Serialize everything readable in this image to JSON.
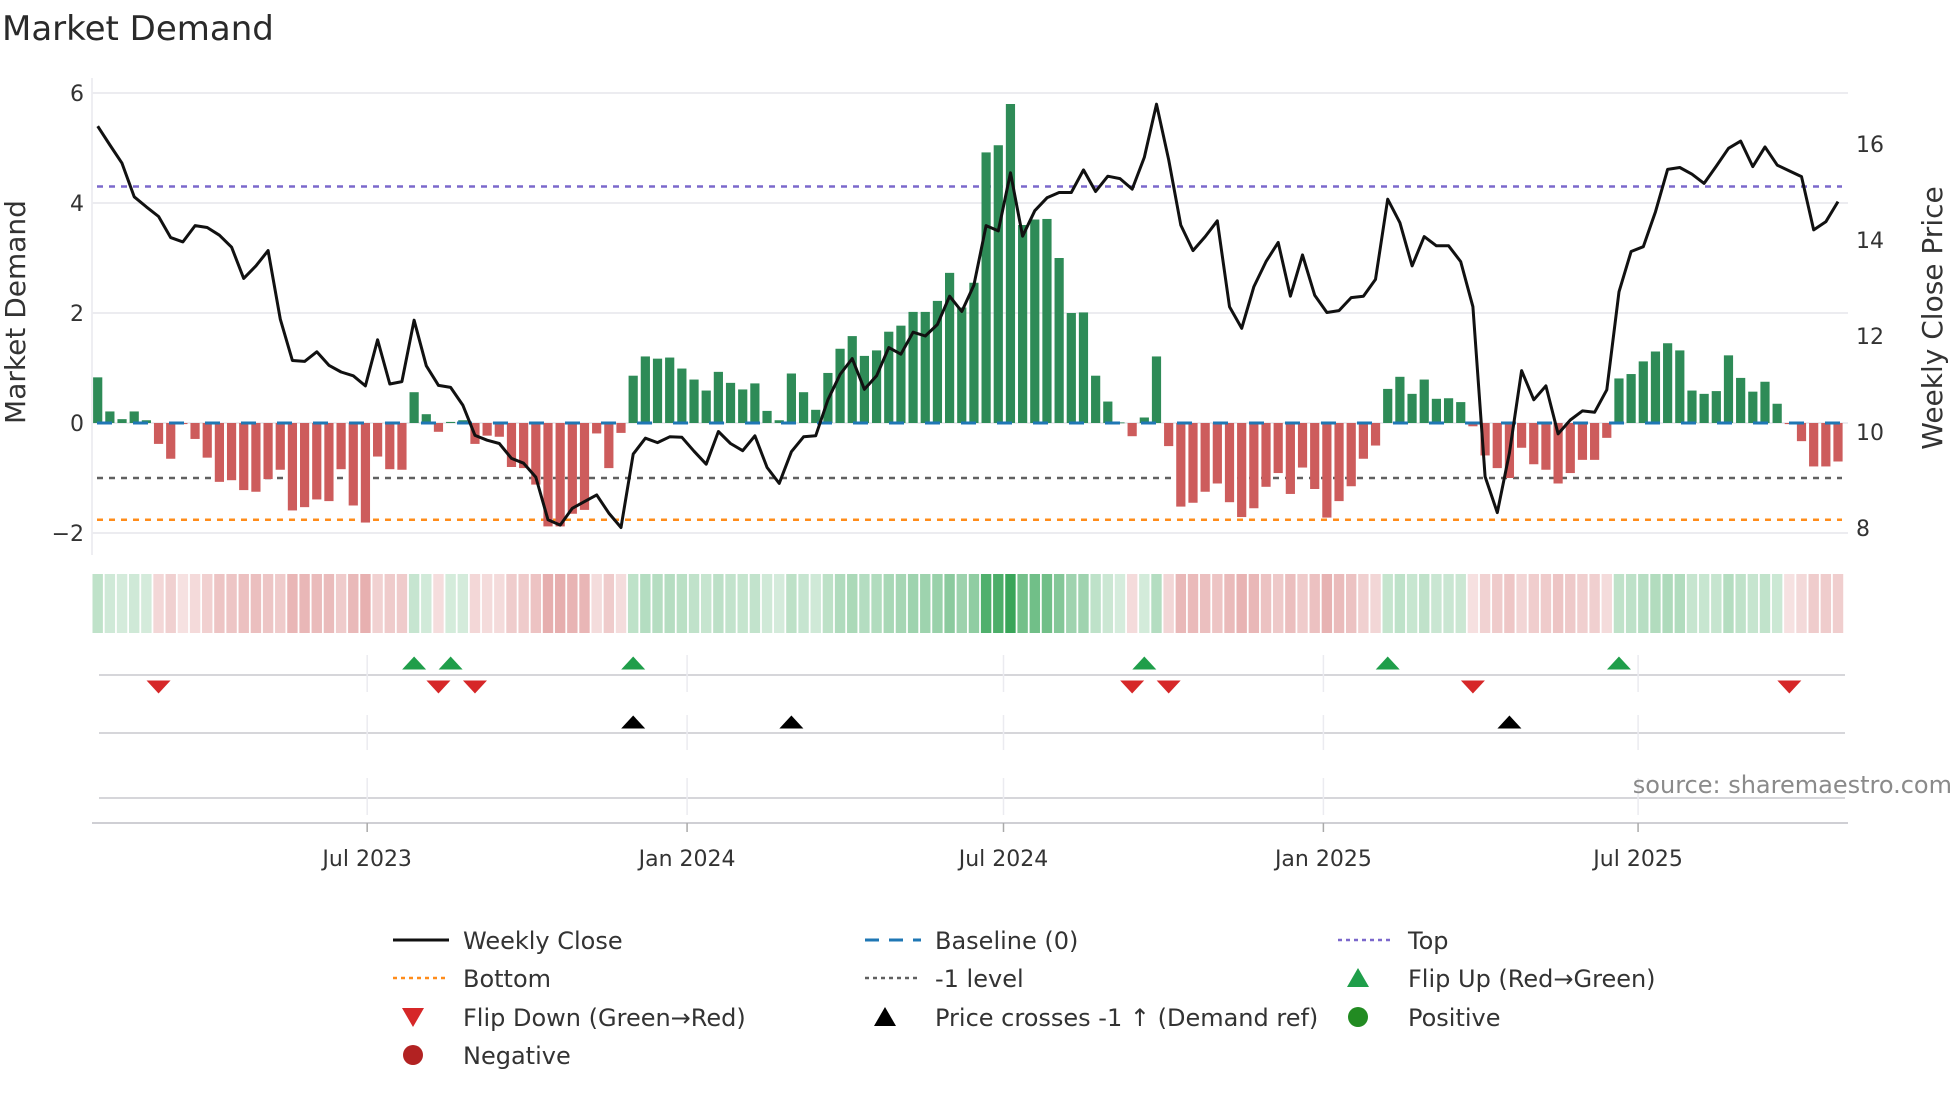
{
  "chart_data": {
    "type": "bar",
    "title": "Market Demand",
    "ylabel": "Market Demand",
    "y2label": "Weekly Close Price",
    "ylim": [
      -2.25,
      6.3
    ],
    "y2lim": [
      7.8,
      17.2
    ],
    "yticks": [
      "6",
      "4",
      "2",
      "0",
      "−2"
    ],
    "ytick_values": [
      6,
      4,
      2,
      0,
      -2
    ],
    "y2ticks": [
      "16",
      "14",
      "12",
      "10",
      "8"
    ],
    "y2tick_values": [
      16,
      14,
      12,
      10,
      8
    ],
    "x_start_date": "2023-01-27",
    "x_frequency": "weekly",
    "xticks": [
      {
        "label": "Jul 2023",
        "date": "2023-07-01"
      },
      {
        "label": "Jan 2024",
        "date": "2024-01-01"
      },
      {
        "label": "Jul 2024",
        "date": "2024-07-01"
      },
      {
        "label": "Jan 2025",
        "date": "2025-01-01"
      },
      {
        "label": "Jul 2025",
        "date": "2025-07-01"
      }
    ],
    "grid": true,
    "series": [
      {
        "name": "Market Demand",
        "kind": "bar",
        "values": [
          0.83,
          0.21,
          0.07,
          0.21,
          0.05,
          -0.38,
          -0.65,
          -0.02,
          -0.29,
          -0.63,
          -1.07,
          -1.04,
          -1.22,
          -1.25,
          -1.02,
          -0.85,
          -1.59,
          -1.53,
          -1.39,
          -1.42,
          -0.84,
          -1.5,
          -1.81,
          -0.61,
          -0.84,
          -0.85,
          0.56,
          0.16,
          -0.16,
          0.02,
          0.05,
          -0.38,
          -0.23,
          -0.25,
          -0.8,
          -0.82,
          -1.12,
          -1.88,
          -1.88,
          -1.65,
          -1.58,
          -0.19,
          -0.82,
          -0.18,
          0.86,
          1.21,
          1.17,
          1.19,
          0.99,
          0.79,
          0.59,
          0.93,
          0.73,
          0.61,
          0.72,
          0.22,
          0.05,
          0.9,
          0.56,
          0.24,
          0.91,
          1.35,
          1.58,
          1.22,
          1.32,
          1.66,
          1.77,
          2.02,
          2.02,
          2.22,
          2.73,
          2.1,
          2.55,
          4.92,
          5.05,
          5.8,
          3.6,
          3.7,
          3.71,
          3.0,
          2.0,
          2.01,
          0.86,
          0.39,
          0.01,
          -0.24,
          0.1,
          1.21,
          -0.42,
          -1.52,
          -1.45,
          -1.25,
          -1.1,
          -1.44,
          -1.71,
          -1.55,
          -1.16,
          -0.91,
          -1.29,
          -0.81,
          -1.2,
          -1.72,
          -1.42,
          -1.15,
          -0.65,
          -0.41,
          0.62,
          0.84,
          0.53,
          0.79,
          0.44,
          0.45,
          0.38,
          -0.06,
          -0.59,
          -0.82,
          -1.0,
          -0.45,
          -0.75,
          -0.85,
          -1.1,
          -0.91,
          -0.67,
          -0.67,
          -0.27,
          0.81,
          0.89,
          1.12,
          1.3,
          1.45,
          1.32,
          0.59,
          0.53,
          0.58,
          1.23,
          0.82,
          0.57,
          0.75,
          0.35,
          -0.02,
          -0.33,
          -0.79,
          -0.79,
          -0.7
        ]
      },
      {
        "name": "Weekly Close",
        "kind": "line",
        "axis": "right",
        "values": [
          16.37,
          15.98,
          15.6,
          14.9,
          14.69,
          14.49,
          14.05,
          13.96,
          14.3,
          14.26,
          14.1,
          13.85,
          13.2,
          13.46,
          13.78,
          12.35,
          11.49,
          11.47,
          11.67,
          11.39,
          11.25,
          11.17,
          10.96,
          11.92,
          11.0,
          11.05,
          12.33,
          11.38,
          10.97,
          10.93,
          10.56,
          9.93,
          9.83,
          9.76,
          9.45,
          9.35,
          9.06,
          8.17,
          8.06,
          8.41,
          8.55,
          8.69,
          8.31,
          8.01,
          9.54,
          9.87,
          9.78,
          9.9,
          9.89,
          9.6,
          9.33,
          10.01,
          9.76,
          9.61,
          9.92,
          9.26,
          8.93,
          9.59,
          9.9,
          9.92,
          10.67,
          11.2,
          11.53,
          10.89,
          11.17,
          11.76,
          11.62,
          12.08,
          12.0,
          12.24,
          12.83,
          12.51,
          13.06,
          14.3,
          14.19,
          15.4,
          14.08,
          14.61,
          14.88,
          14.99,
          14.99,
          15.46,
          15.01,
          15.33,
          15.28,
          15.06,
          15.72,
          16.83,
          15.67,
          14.31,
          13.78,
          14.07,
          14.4,
          12.61,
          12.16,
          13.03,
          13.55,
          13.95,
          12.83,
          13.69,
          12.85,
          12.49,
          12.53,
          12.8,
          12.83,
          13.18,
          14.85,
          14.36,
          13.46,
          14.07,
          13.88,
          13.88,
          13.55,
          12.61,
          9.07,
          8.32,
          9.56,
          11.28,
          10.67,
          10.96,
          9.96,
          10.25,
          10.44,
          10.41,
          10.88,
          12.92,
          13.76,
          13.86,
          14.59,
          15.47,
          15.51,
          15.37,
          15.18,
          15.54,
          15.91,
          16.06,
          15.53,
          15.94,
          15.56,
          15.44,
          15.32,
          14.21,
          14.38,
          14.8
        ]
      }
    ],
    "levels": {
      "top": 4.3,
      "bottom": -1.76,
      "minus_one": -1,
      "baseline": 0
    },
    "markers": {
      "flip_up_week_index": [
        26,
        29,
        44,
        86,
        106,
        125
      ],
      "flip_down_week_index": [
        5,
        28,
        31,
        85,
        88,
        113,
        139
      ],
      "price_cross_week_index": [
        44,
        57,
        116
      ]
    },
    "colors": {
      "positive_bar": "#2e8b57",
      "negative_bar": "#cd5c5c",
      "close_line": "#111111",
      "baseline": "#1f77b4",
      "top": "#7b68cc",
      "bottom": "#ff8c1a",
      "minus_one": "#606060",
      "flip_up": "#1f9e4a",
      "flip_down": "#d62728",
      "price_cross": "#000000",
      "positive_dot": "#228b22",
      "negative_dot": "#b22222"
    },
    "legend_position": "bottom",
    "legend": [
      {
        "label": "Weekly Close",
        "kind": "line"
      },
      {
        "label": "Baseline (0)",
        "kind": "dash"
      },
      {
        "label": "Top",
        "kind": "dot-top"
      },
      {
        "label": "Bottom",
        "kind": "dot-bottom"
      },
      {
        "label": "-1 level",
        "kind": "dot-minus1"
      },
      {
        "label": "Flip Up (Red→Green)",
        "kind": "tri-up-green"
      },
      {
        "label": "Flip Down (Green→Red)",
        "kind": "tri-down-red"
      },
      {
        "label": "Price crosses -1 ↑ (Demand ref)",
        "kind": "tri-up-black"
      },
      {
        "label": "Positive",
        "kind": "dot-green"
      },
      {
        "label": "Negative",
        "kind": "dot-red"
      }
    ],
    "annotation": "source: sharemaestro.com"
  }
}
